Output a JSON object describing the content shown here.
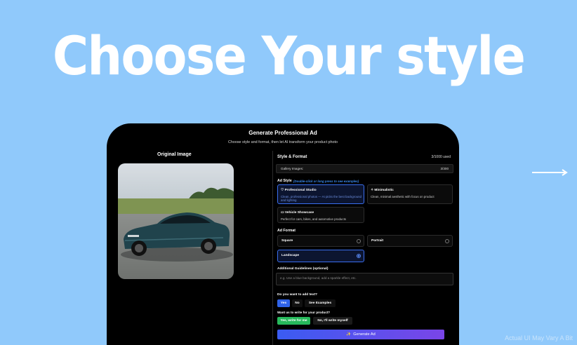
{
  "headline": "Choose Your style",
  "disclaimer": "Actual UI May Vary A Bit",
  "app": {
    "title": "Generate Professional Ad",
    "subtitle": "Choose style and format, then let AI transform your product photo",
    "original_label": "Original Image",
    "panel": {
      "title": "Style & Format",
      "usage": "3/1000 used",
      "gallery_label": "Gallery Images:",
      "gallery_count": "3/300",
      "ad_style_label": "Ad Style",
      "ad_style_hint": "(Double-click or long press to see examples)",
      "styles": [
        {
          "title": "♡ Professional Studio",
          "desc": "Clean, professional photos — AI picks the best background and lighting"
        },
        {
          "title": "✧ Minimalistic",
          "desc": "Clean, minimal aesthetic with focus on product"
        },
        {
          "title": "▭ Vehicle Showcase",
          "desc": "Perfect for cars, bikes, and automotive products"
        }
      ],
      "ad_format_label": "Ad Format",
      "formats": [
        "Square",
        "Portrait",
        "Landscape"
      ],
      "guidelines_label": "Additional Guidelines (optional)",
      "guidelines_placeholder": "e.g. Use a blue background, add a sparkle effect, etc.",
      "add_text_question": "Do you want to add text?",
      "add_text_options": [
        "Yes",
        "No",
        "See Examples"
      ],
      "write_question": "Want us to write for your product?",
      "write_options": [
        "Yes, write for me",
        "No, I'll write myself"
      ],
      "generate_label": "Generate Ad",
      "generate_icon": "sparkle-icon"
    }
  },
  "colors": {
    "background": "#90c9fb",
    "accent_blue": "#2f63e8",
    "accent_green": "#27b95c",
    "generate_gradient": [
      "#3a5cf2",
      "#7a45e8"
    ]
  }
}
